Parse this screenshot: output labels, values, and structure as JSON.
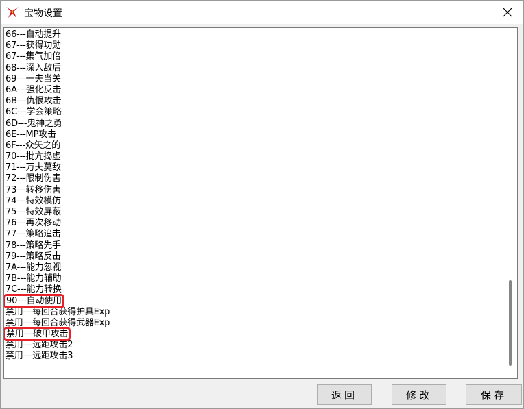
{
  "window": {
    "title": "宝物设置"
  },
  "list": {
    "items": [
      "66---自动提升",
      "67---获得功勋",
      "67---集气加倍",
      "68---深入敌后",
      "69---一夫当关",
      "6A---强化反击",
      "6B---仇恨攻击",
      "6C---学会策略",
      "6D---鬼神之勇",
      "6E---MP攻击",
      "6F---众矢之的",
      "70---批亢捣虚",
      "71---万夫莫敌",
      "72---限制伤害",
      "73---转移伤害",
      "74---特效模仿",
      "75---特效屏蔽",
      "76---再次移动",
      "77---策略追击",
      "78---策略先手",
      "79---策略反击",
      "7A---能力忽视",
      "7B---能力辅助",
      "7C---能力转换",
      "90---自动使用",
      "禁用---每回合获得护具Exp",
      "禁用---每回合获得武器Exp",
      "禁用---破甲攻击",
      "禁用---远距攻击2",
      "禁用---远距攻击3"
    ],
    "highlighted": [
      24,
      27
    ]
  },
  "buttons": {
    "back": "返回",
    "modify": "修改",
    "save": "保存"
  },
  "colors": {
    "highlight": "#e8202a",
    "icon": "#c8161d"
  }
}
